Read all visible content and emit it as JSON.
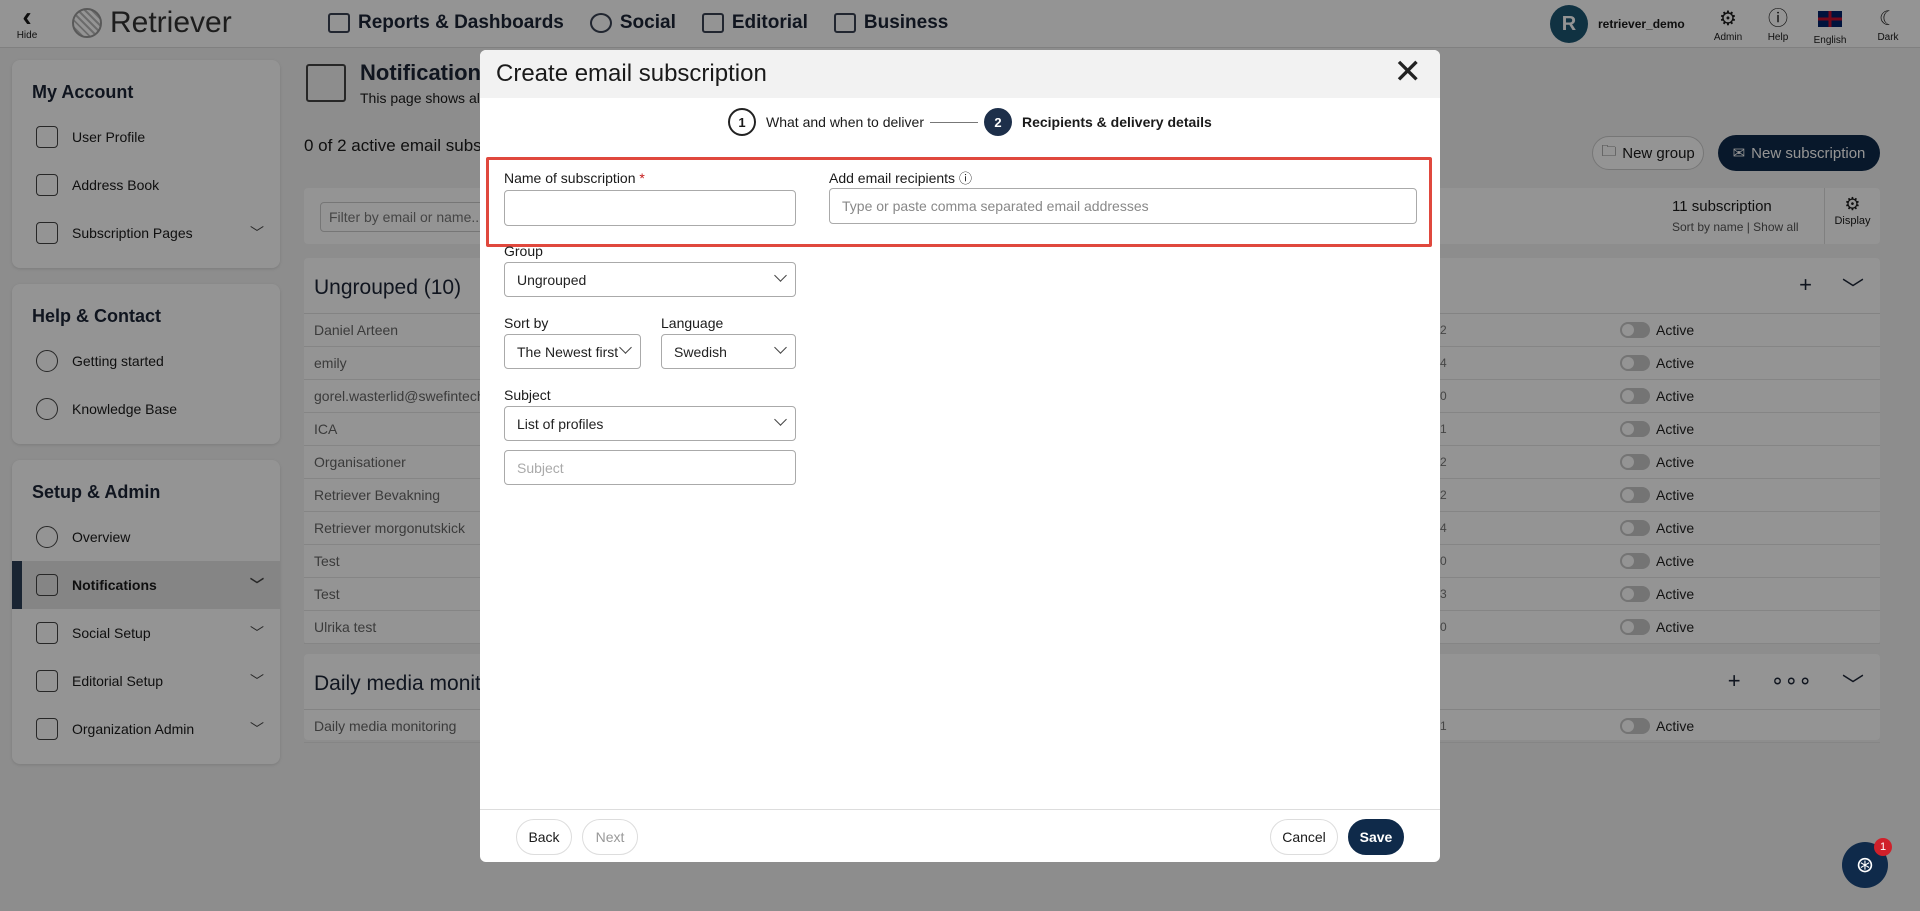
{
  "topbar": {
    "hide_label": "Hide",
    "logo_text": "Retriever",
    "nav": [
      {
        "label": "Reports & Dashboards"
      },
      {
        "label": "Social"
      },
      {
        "label": "Editorial"
      },
      {
        "label": "Business"
      }
    ],
    "user": {
      "initial": "R",
      "name": "retriever_demo"
    },
    "tools": {
      "admin": "Admin",
      "help": "Help",
      "language": "English",
      "dark": "Dark"
    }
  },
  "sidebar": {
    "account": {
      "heading": "My Account",
      "items": [
        "User Profile",
        "Address Book",
        "Subscription Pages"
      ]
    },
    "help": {
      "heading": "Help & Contact",
      "items": [
        "Getting started",
        "Knowledge Base"
      ]
    },
    "setup": {
      "heading": "Setup & Admin",
      "items": [
        "Overview",
        "Notifications",
        "Social Setup",
        "Editorial Setup",
        "Organization Admin"
      ]
    }
  },
  "main": {
    "title": "Notification",
    "subtitle": "This page shows al",
    "active_count": "0 of 2 active email subsc",
    "new_group": "New group",
    "new_subscription": "New subscription",
    "filter_placeholder": "Filter by email or name...",
    "sub_count": "11 subscription",
    "sort_by": "Sort by name",
    "show_all": "Show all",
    "display": "Display",
    "groups": [
      {
        "title": "Ungrouped (10)",
        "rows": [
          {
            "name": "Daniel Arteen",
            "count": "2",
            "status": "Active"
          },
          {
            "name": "emily",
            "count": "4",
            "status": "Active"
          },
          {
            "name": "gorel.wasterlid@swefintech",
            "count": "0",
            "status": "Active"
          },
          {
            "name": "ICA",
            "count": "1",
            "status": "Active"
          },
          {
            "name": "Organisationer",
            "count": "2",
            "status": "Active"
          },
          {
            "name": "Retriever Bevakning",
            "count": "2",
            "status": "Active"
          },
          {
            "name": "Retriever morgonutskick",
            "count": "4",
            "status": "Active"
          },
          {
            "name": "Test",
            "count": "0",
            "status": "Active"
          },
          {
            "name": "Test",
            "count": "3",
            "status": "Active"
          },
          {
            "name": "Ulrika test",
            "count": "0",
            "status": "Active"
          }
        ]
      },
      {
        "title": "Daily media monito",
        "rows": [
          {
            "name": "Daily media monitoring",
            "count": "1",
            "status": "Active"
          }
        ]
      }
    ]
  },
  "modal": {
    "title": "Create email subscription",
    "steps": [
      {
        "num": "1",
        "label": "What and when to deliver"
      },
      {
        "num": "2",
        "label": "Recipients & delivery details"
      }
    ],
    "name_label": "Name of subscription",
    "required_mark": "*",
    "name_value": "",
    "recipients_label": "Add email recipients",
    "recipients_placeholder": "Type or paste comma separated email addresses",
    "group_label": "Group",
    "group_value": "Ungrouped",
    "sort_label": "Sort by",
    "sort_value": "The Newest first",
    "language_label": "Language",
    "language_value": "Swedish",
    "subject_label": "Subject",
    "subject_value": "List of profiles",
    "subject_placeholder": "Subject",
    "back": "Back",
    "next": "Next",
    "cancel": "Cancel",
    "save": "Save"
  },
  "chat": {
    "badge": "1"
  },
  "colors": {
    "primary": "#0f2a4a",
    "highlight": "#e0483d",
    "avatar": "#1d5673"
  }
}
